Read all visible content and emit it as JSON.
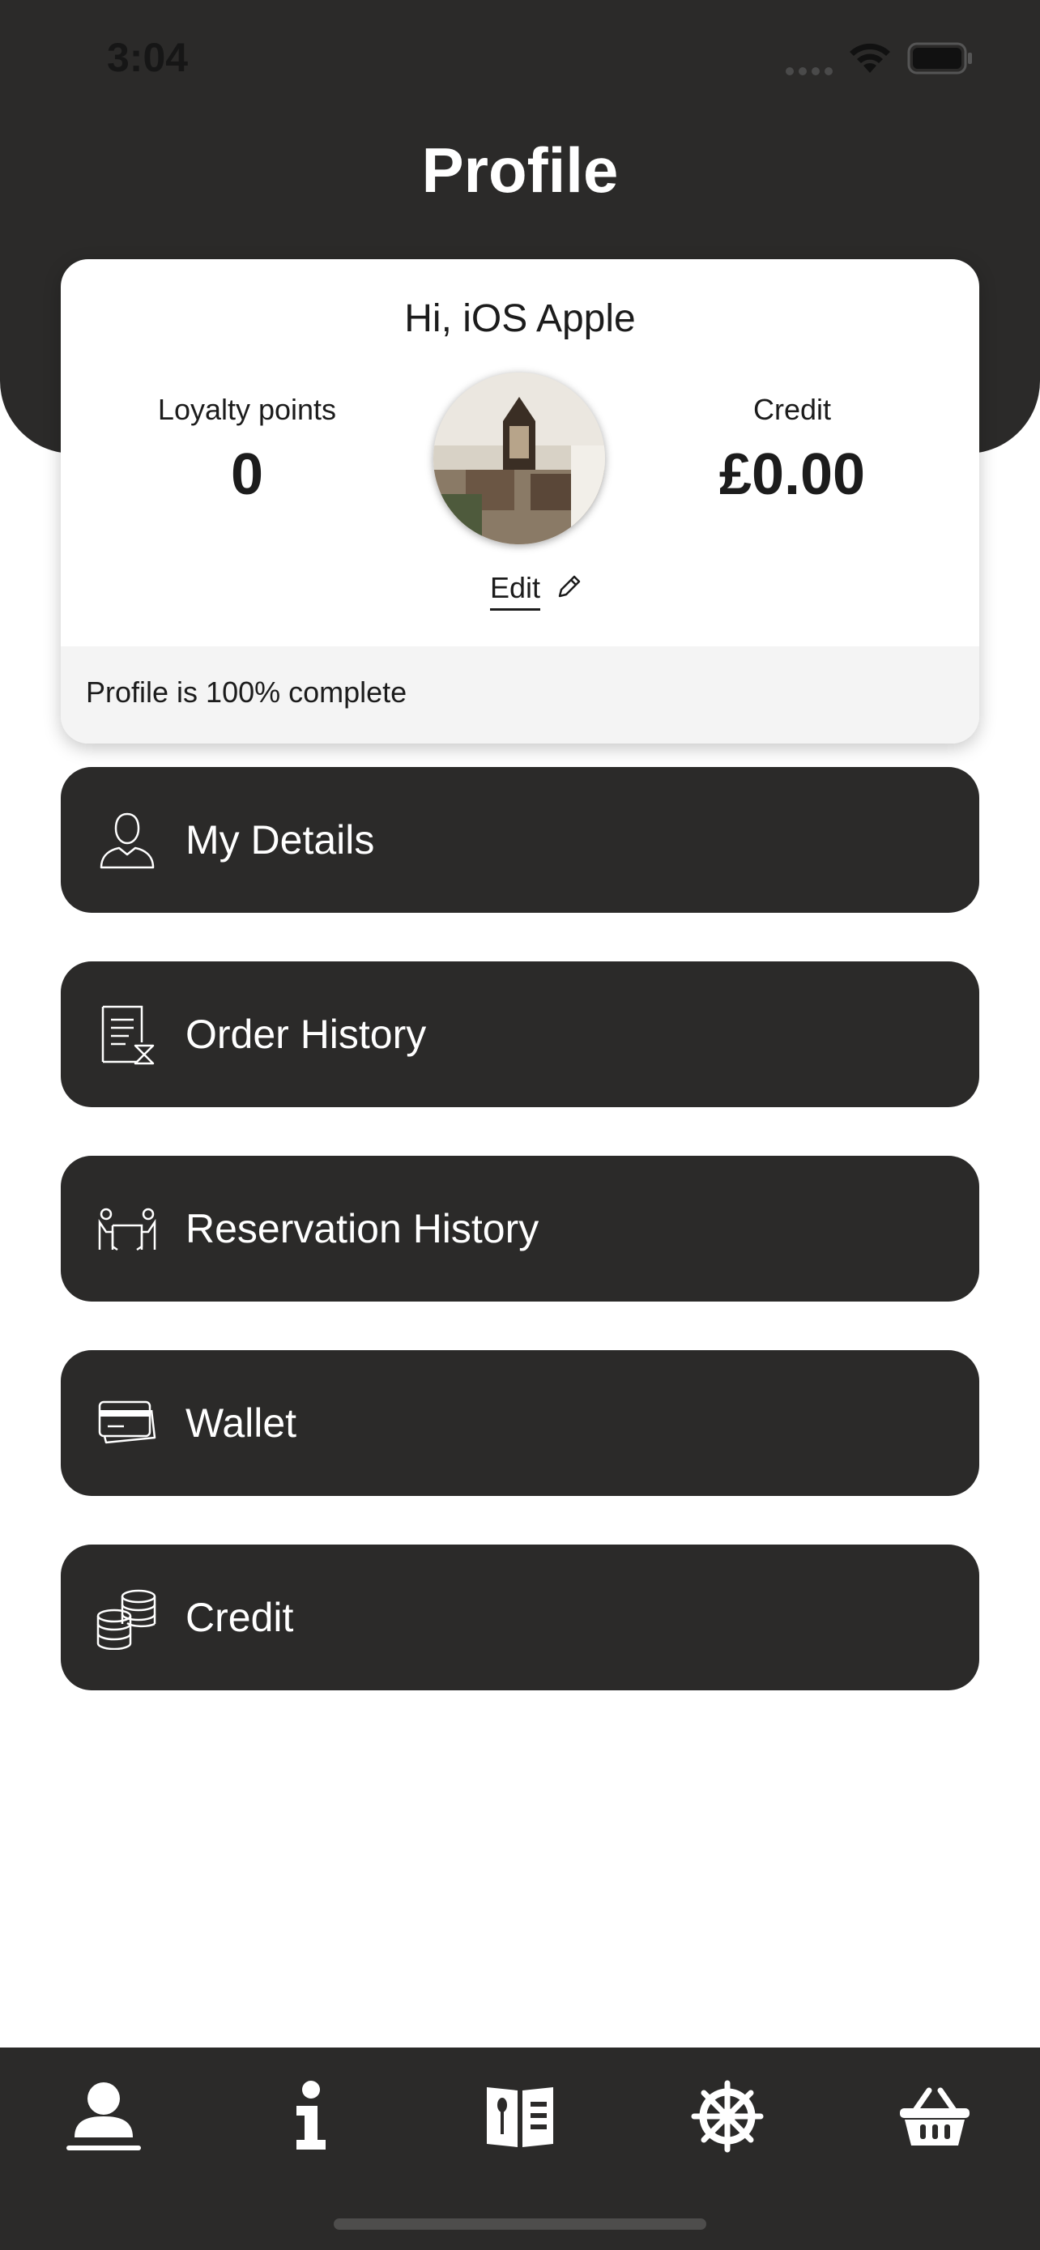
{
  "status_bar": {
    "time": "3:04"
  },
  "header": {
    "title": "Profile"
  },
  "profile_card": {
    "greeting": "Hi, iOS Apple",
    "loyalty": {
      "label": "Loyalty points",
      "value": "0"
    },
    "credit": {
      "label": "Credit",
      "value": "£0.00"
    },
    "edit_label": "Edit",
    "completion_text": "Profile is 100% complete"
  },
  "menu": {
    "items": [
      {
        "label": "My Details",
        "icon": "user-icon"
      },
      {
        "label": "Order History",
        "icon": "receipt-hourglass-icon"
      },
      {
        "label": "Reservation History",
        "icon": "dining-table-icon"
      },
      {
        "label": "Wallet",
        "icon": "credit-card-icon"
      },
      {
        "label": "Credit",
        "icon": "coins-icon"
      }
    ]
  },
  "tab_bar": {
    "tabs": [
      {
        "icon": "profile-icon",
        "active": true
      },
      {
        "icon": "info-icon",
        "active": false
      },
      {
        "icon": "menu-book-icon",
        "active": false
      },
      {
        "icon": "ship-wheel-icon",
        "active": false
      },
      {
        "icon": "basket-icon",
        "active": false
      }
    ]
  },
  "colors": {
    "dark": "#2b2a29",
    "white": "#ffffff",
    "completion_bg": "#f4f4f4"
  }
}
